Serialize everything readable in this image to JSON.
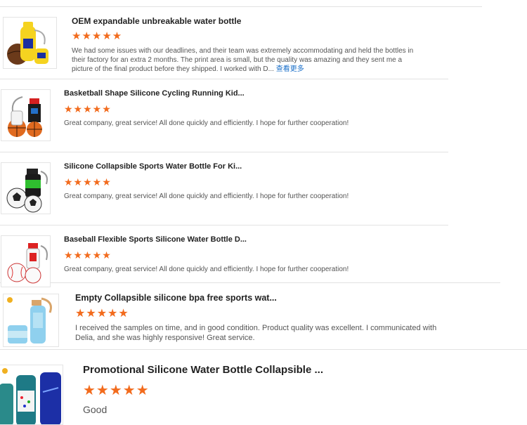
{
  "reviews": [
    {
      "title": "OEM expandable unbreakable water bottle",
      "rating": 5,
      "stars": "★★★★★",
      "text": "We had some issues with our deadlines, and their team was extremely accommodating and held the bottles in their factory for an extra 2 months. The print area is small, but the quality was amazing and they sent me a picture of the final product before they shipped. I worked with D...",
      "more_label": "查看更多"
    },
    {
      "title": "Basketball Shape Silicone Cycling Running Kid...",
      "rating": 5,
      "stars": "★★★★★",
      "text": "Great company, great service! All done quickly and efficiently. I hope for further cooperation!"
    },
    {
      "title": "Silicone Collapsible Sports Water Bottle For Ki...",
      "rating": 5,
      "stars": "★★★★★",
      "text": "Great company, great service! All done quickly and efficiently. I hope for further cooperation!"
    },
    {
      "title": "Baseball Flexible Sports Silicone Water Bottle D...",
      "rating": 5,
      "stars": "★★★★★",
      "text": "Great company, great service! All done quickly and efficiently. I hope for further cooperation!"
    },
    {
      "title": "Empty Collapsible silicone bpa free sports wat...",
      "rating": 5,
      "stars": "★★★★★",
      "text": "I received the samples on time, and in good condition. Product quality was excellent. I communicated with Delia, and she was highly responsive! Great service."
    },
    {
      "title": "Promotional Silicone Water Bottle Collapsible ...",
      "rating": 5,
      "stars": "★★★★★",
      "text": "Good"
    }
  ],
  "colors": {
    "star": "#f26b1d",
    "link": "#1a6fc9",
    "divider": "#e2e2e2"
  }
}
